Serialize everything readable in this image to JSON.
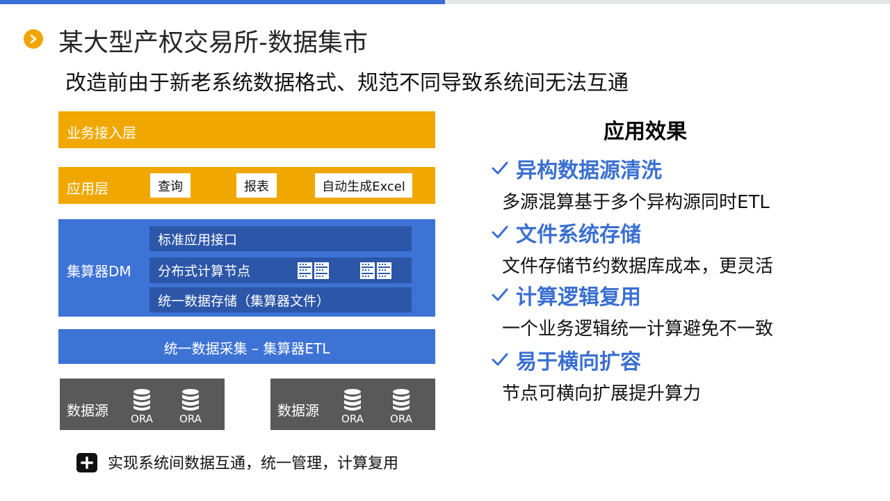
{
  "slide": {
    "title": "某大型产权交易所-数据集市",
    "subtitle": "改造前由于新老系统数据格式、规范不同导致系统间无法互通",
    "accent_color": "#3a6fd8",
    "bullet_color": "#f0a500"
  },
  "architecture": {
    "business_layer": "业务接入层",
    "app_layer": {
      "label": "应用层",
      "boxes": [
        "查询",
        "报表",
        "自动生成Excel"
      ]
    },
    "dm_layer": {
      "label": "集算器DM",
      "rows": [
        "标准应用接口",
        "分布式计算节点",
        "统一数据存储（集算器文件）"
      ],
      "server_icon": "server-rack-icon"
    },
    "etl_layer": "统一数据采集 – 集算器ETL",
    "sources": [
      {
        "label": "数据源",
        "dbs": [
          "ORA",
          "ORA"
        ]
      },
      {
        "label": "数据源",
        "dbs": [
          "ORA",
          "ORA"
        ]
      }
    ],
    "colors": {
      "orange": "#f0a800",
      "blue": "#3e73d6",
      "dark_blue": "#2c56a8",
      "gray": "#595959"
    }
  },
  "footnote": "实现系统间数据互通，统一管理，计算复用",
  "effects": {
    "heading": "应用效果",
    "items": [
      {
        "title": "异构数据源清洗",
        "desc": "多源混算基于多个异构源同时ETL"
      },
      {
        "title": "文件系统存储",
        "desc": "文件存储节约数据库成本，更灵活"
      },
      {
        "title": "计算逻辑复用",
        "desc": "一个业务逻辑统一计算避免不一致"
      },
      {
        "title": "易于横向扩容",
        "desc": "节点可横向扩展提升算力"
      }
    ],
    "title_color": "#3a6fd0"
  }
}
